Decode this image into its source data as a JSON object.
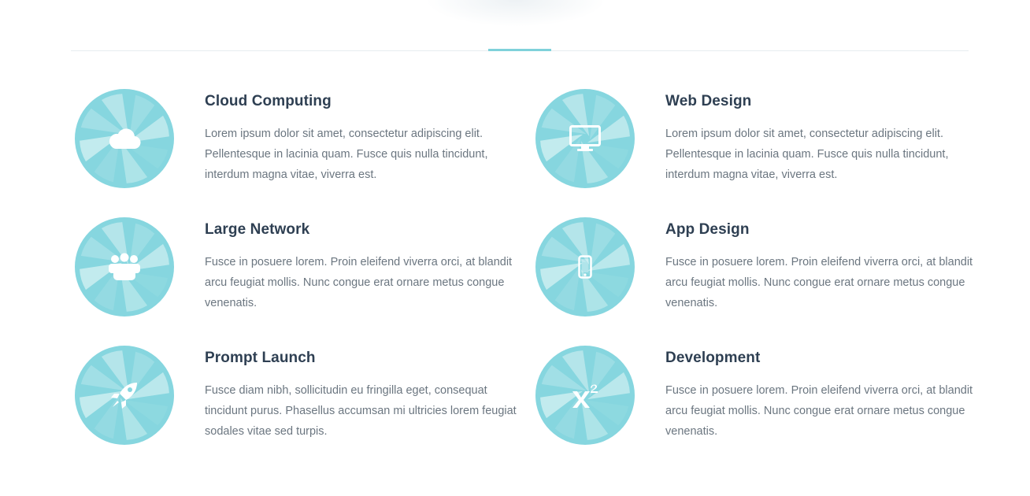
{
  "colors": {
    "accent": "#7fd1da",
    "circle_base": "#86d6df",
    "heading": "#2e3f52",
    "body_text": "#6b7680"
  },
  "services": [
    {
      "title": "Cloud Computing",
      "icon": "cloud-icon",
      "description": "Lorem ipsum dolor sit amet, consectetur adipiscing elit. Pellentesque in lacinia quam. Fusce quis nulla tincidunt, interdum magna vitae, viverra est."
    },
    {
      "title": "Web Design",
      "icon": "monitor-icon",
      "description": "Lorem ipsum dolor sit amet, consectetur adipiscing elit. Pellentesque in lacinia quam. Fusce quis nulla tincidunt, interdum magna vitae, viverra est."
    },
    {
      "title": "Large Network",
      "icon": "users-group-icon",
      "description": "Fusce in posuere lorem. Proin eleifend viverra orci, at blandit arcu feugiat mollis. Nunc congue erat ornare metus congue venenatis."
    },
    {
      "title": "App Design",
      "icon": "mobile-phone-icon",
      "description": "Fusce in posuere lorem. Proin eleifend viverra orci, at blandit arcu feugiat mollis. Nunc congue erat ornare metus congue venenatis."
    },
    {
      "title": "Prompt Launch",
      "icon": "rocket-icon",
      "description": "Fusce diam nibh, sollicitudin eu fringilla eget, consequat tincidunt purus. Phasellus accumsan mi ultricies lorem feugiat sodales vitae sed turpis."
    },
    {
      "title": "Development",
      "icon": "superscript-icon",
      "description": "Fusce in posuere lorem. Proin eleifend viverra orci, at blandit arcu feugiat mollis. Nunc congue erat ornare metus congue venenatis."
    }
  ]
}
